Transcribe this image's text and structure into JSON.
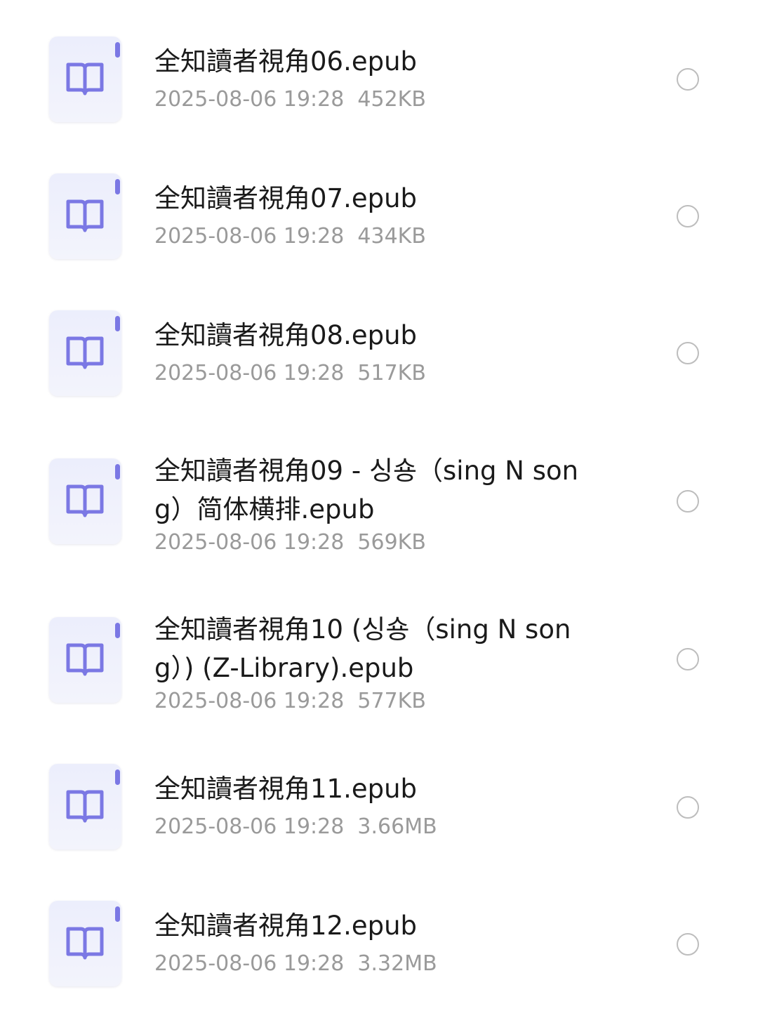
{
  "files": [
    {
      "name": "全知讀者視角06.epub",
      "date": "2025-08-06 19:28",
      "size": "452KB",
      "icon": "book-icon"
    },
    {
      "name": "全知讀者視角07.epub",
      "date": "2025-08-06 19:28",
      "size": "434KB",
      "icon": "book-icon"
    },
    {
      "name": "全知讀者視角08.epub",
      "date": "2025-08-06 19:28",
      "size": "517KB",
      "icon": "book-icon"
    },
    {
      "name": "全知讀者視角09 - 싱숑（sing N song）简体横排.epub",
      "date": "2025-08-06 19:28",
      "size": "569KB",
      "icon": "book-icon"
    },
    {
      "name": "全知讀者視角10 (싱숑（sing N song）) (Z-Library).epub",
      "date": "2025-08-06 19:28",
      "size": "577KB",
      "icon": "book-icon"
    },
    {
      "name": "全知讀者視角11.epub",
      "date": "2025-08-06 19:28",
      "size": "3.66MB",
      "icon": "book-icon"
    },
    {
      "name": "全知讀者視角12.epub",
      "date": "2025-08-06 19:28",
      "size": "3.32MB",
      "icon": "book-icon"
    }
  ],
  "colors": {
    "icon_accent": "#7b78e4",
    "icon_bg": "#eceefc",
    "title_text": "#1a1a1a",
    "meta_text": "#9a9a9a",
    "radio_border": "#bdbdbd"
  }
}
